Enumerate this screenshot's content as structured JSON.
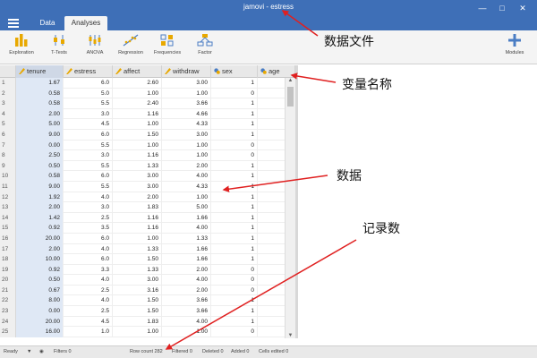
{
  "window": {
    "title": "jamovi - estress"
  },
  "tabs": [
    {
      "label": "Data",
      "active": false
    },
    {
      "label": "Analyses",
      "active": true
    }
  ],
  "ribbon": {
    "items": [
      {
        "label": "Exploration",
        "icon": "exploration-icon"
      },
      {
        "label": "T-Tests",
        "icon": "ttests-icon"
      },
      {
        "label": "ANOVA",
        "icon": "anova-icon"
      },
      {
        "label": "Regression",
        "icon": "regression-icon"
      },
      {
        "label": "Frequencies",
        "icon": "frequencies-icon"
      },
      {
        "label": "Factor",
        "icon": "factor-icon"
      }
    ],
    "modules": {
      "label": "Modules",
      "icon": "plus-icon"
    }
  },
  "grid": {
    "columns": [
      {
        "name": "tenure",
        "type": "continuous"
      },
      {
        "name": "estress",
        "type": "continuous"
      },
      {
        "name": "affect",
        "type": "continuous"
      },
      {
        "name": "withdraw",
        "type": "continuous"
      },
      {
        "name": "sex",
        "type": "nominal"
      },
      {
        "name": "age",
        "type": "nominal"
      }
    ],
    "rows": [
      [
        "1",
        "1.67",
        "6.0",
        "2.60",
        "3.00",
        "1"
      ],
      [
        "2",
        "0.58",
        "5.0",
        "1.00",
        "1.00",
        "0"
      ],
      [
        "3",
        "0.58",
        "5.5",
        "2.40",
        "3.66",
        "1"
      ],
      [
        "4",
        "2.00",
        "3.0",
        "1.16",
        "4.66",
        "1"
      ],
      [
        "5",
        "5.00",
        "4.5",
        "1.00",
        "4.33",
        "1"
      ],
      [
        "6",
        "9.00",
        "6.0",
        "1.50",
        "3.00",
        "1"
      ],
      [
        "7",
        "0.00",
        "5.5",
        "1.00",
        "1.00",
        "0"
      ],
      [
        "8",
        "2.50",
        "3.0",
        "1.16",
        "1.00",
        "0"
      ],
      [
        "9",
        "0.50",
        "5.5",
        "1.33",
        "2.00",
        "1"
      ],
      [
        "10",
        "0.58",
        "6.0",
        "3.00",
        "4.00",
        "1"
      ],
      [
        "11",
        "9.00",
        "5.5",
        "3.00",
        "4.33",
        "1"
      ],
      [
        "12",
        "1.92",
        "4.0",
        "2.00",
        "1.00",
        "1"
      ],
      [
        "13",
        "2.00",
        "3.0",
        "1.83",
        "5.00",
        "1"
      ],
      [
        "14",
        "1.42",
        "2.5",
        "1.16",
        "1.66",
        "1"
      ],
      [
        "15",
        "0.92",
        "3.5",
        "1.16",
        "4.00",
        "1"
      ],
      [
        "16",
        "20.00",
        "6.0",
        "1.00",
        "1.33",
        "1"
      ],
      [
        "17",
        "2.00",
        "4.0",
        "1.33",
        "1.66",
        "1"
      ],
      [
        "18",
        "10.00",
        "6.0",
        "1.50",
        "1.66",
        "1"
      ],
      [
        "19",
        "0.92",
        "3.3",
        "1.33",
        "2.00",
        "0"
      ],
      [
        "20",
        "0.50",
        "4.0",
        "3.00",
        "4.00",
        "0"
      ],
      [
        "21",
        "0.67",
        "2.5",
        "3.16",
        "2.00",
        "0"
      ],
      [
        "22",
        "8.00",
        "4.0",
        "1.50",
        "3.66",
        "1"
      ],
      [
        "23",
        "0.00",
        "2.5",
        "1.50",
        "3.66",
        "1"
      ],
      [
        "24",
        "20.00",
        "4.5",
        "1.83",
        "4.00",
        "1"
      ],
      [
        "25",
        "16.00",
        "1.0",
        "1.00",
        "1.00",
        "0"
      ]
    ]
  },
  "status": {
    "ready": "Ready",
    "filters": "Filters 0",
    "row_count": "Row count 282",
    "filtered": "Filtered 0",
    "deleted": "Deleted 0",
    "added": "Added 0",
    "cells_edited": "Cells edited 0"
  },
  "annotations": {
    "data_file": "数据文件",
    "variable_names": "变量名称",
    "data": "数据",
    "record_count": "记录数"
  },
  "colors": {
    "titlebar": "#3e6fb7",
    "accent": "#3e6fb7",
    "arrow": "#e02020"
  }
}
